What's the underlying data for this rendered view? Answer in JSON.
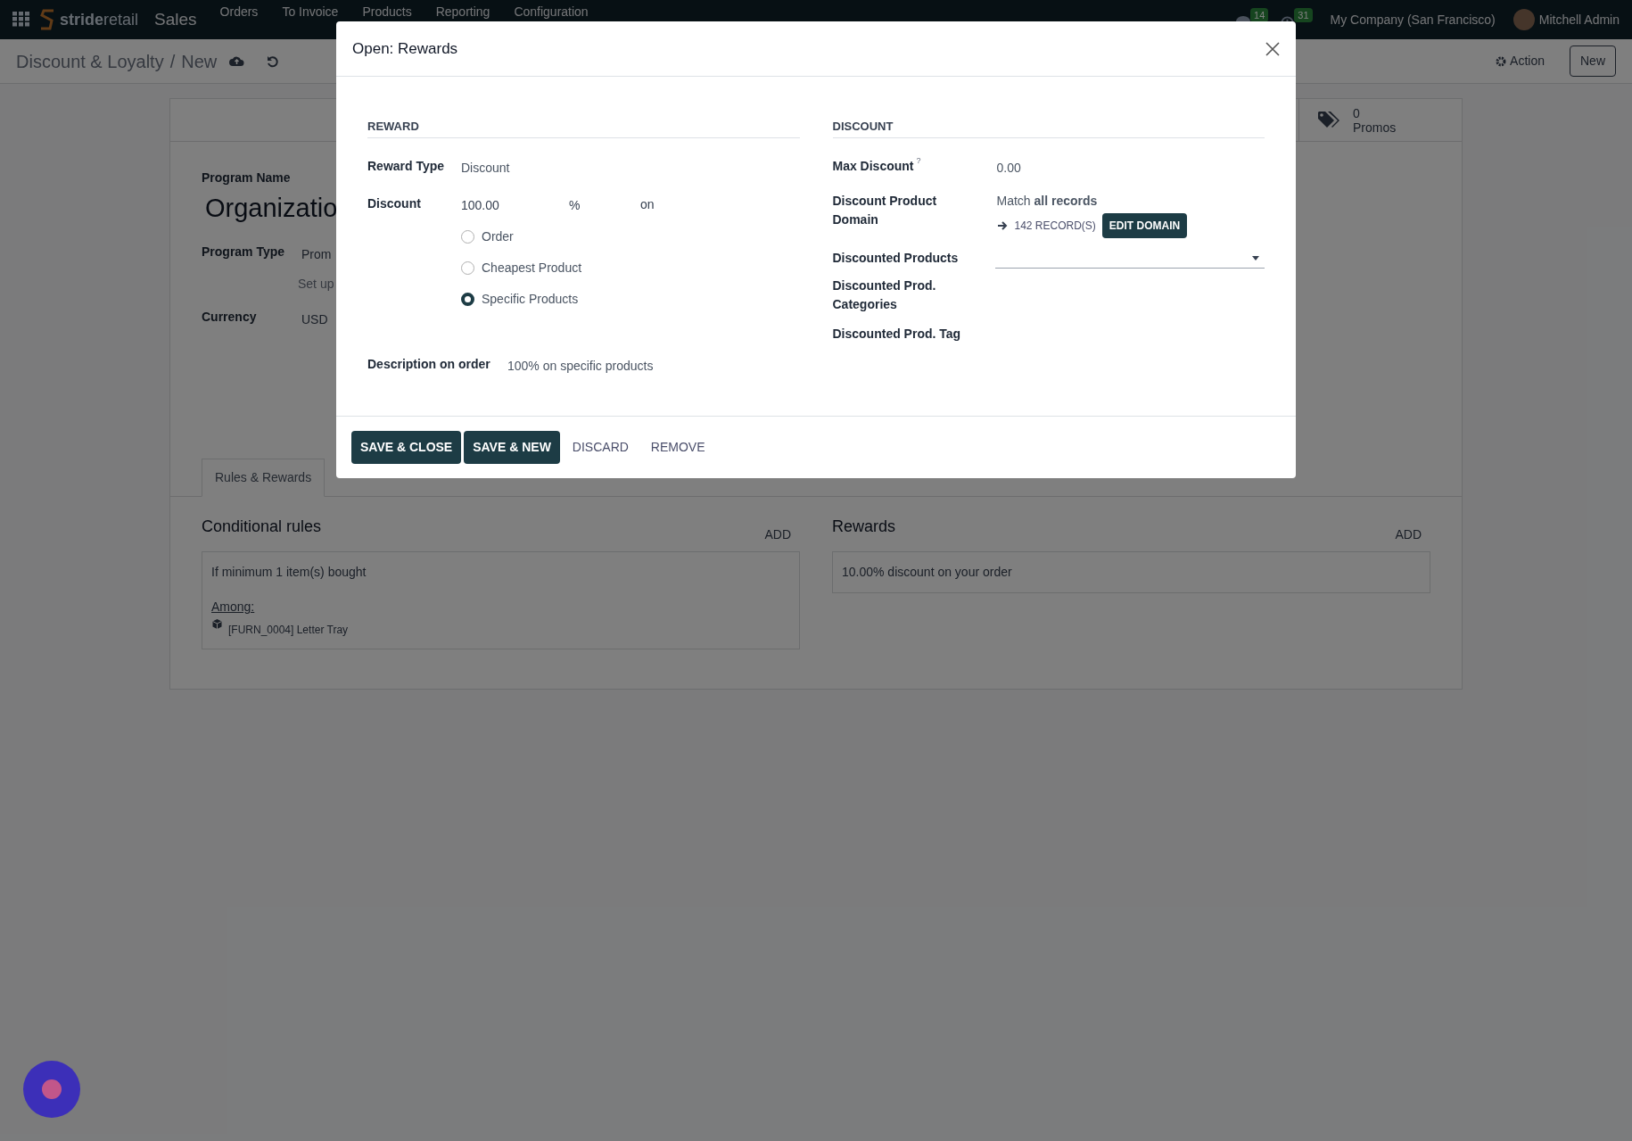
{
  "navbar": {
    "brand_bold": "stride",
    "brand_light": "retail",
    "app": "Sales",
    "menu": [
      "Orders",
      "To Invoice",
      "Products",
      "Reporting",
      "Configuration"
    ],
    "messages_count": "14",
    "activities_count": "31",
    "company": "My Company (San Francisco)",
    "user": "Mitchell Admin"
  },
  "control_panel": {
    "breadcrumb_parent": "Discount & Loyalty",
    "separator": "/",
    "breadcrumb_current": "New",
    "action": "Action",
    "new": "New"
  },
  "form": {
    "stat": {
      "value": "0",
      "label": "Promos"
    },
    "program_name_label": "Program Name",
    "program_name": "Organizatio",
    "fields": [
      {
        "label": "Program Type",
        "value": "Prom",
        "hint": "Set up"
      },
      {
        "label": "Currency",
        "value": "USD"
      }
    ],
    "tabs": [
      {
        "label": "Rules & Rewards",
        "selected": true
      }
    ],
    "conditional_rules": {
      "title": "Conditional rules",
      "add": "ADD",
      "text": "If minimum 1 item(s) bought",
      "among": "Among:",
      "product": "[FURN_0004] Letter Tray"
    },
    "rewards": {
      "title": "Rewards",
      "add": "ADD",
      "items": [
        "10.00% discount on your order"
      ]
    }
  },
  "dialog": {
    "title": "Open: Rewards",
    "reward": {
      "heading": "REWARD",
      "reward_type_label": "Reward Type",
      "reward_type": "Discount",
      "discount_label": "Discount",
      "discount": "100.00",
      "unit": "%",
      "on": "on",
      "options": [
        {
          "label": "Order",
          "selected": false
        },
        {
          "label": "Cheapest Product",
          "selected": false
        },
        {
          "label": "Specific Products",
          "selected": true
        }
      ],
      "description_label": "Description on order",
      "description": "100% on specific products"
    },
    "discount": {
      "heading": "DISCOUNT",
      "max_discount_label": "Max Discount",
      "help_mark": "?",
      "max_discount": "0.00",
      "domain_label": "Discount Product Domain",
      "domain_match": "Match **all records**",
      "records": "142 RECORD(S)",
      "edit_domain": "EDIT DOMAIN",
      "products_label": "Discounted Products",
      "categories_label": "Discounted Prod. Categories",
      "tag_label": "Discounted Prod. Tag"
    },
    "buttons": [
      {
        "label": "SAVE & CLOSE",
        "kind": "primary"
      },
      {
        "label": "SAVE & NEW",
        "kind": "primary"
      },
      {
        "label": "DISCARD",
        "kind": "link"
      },
      {
        "label": "REMOVE",
        "kind": "link"
      }
    ]
  }
}
